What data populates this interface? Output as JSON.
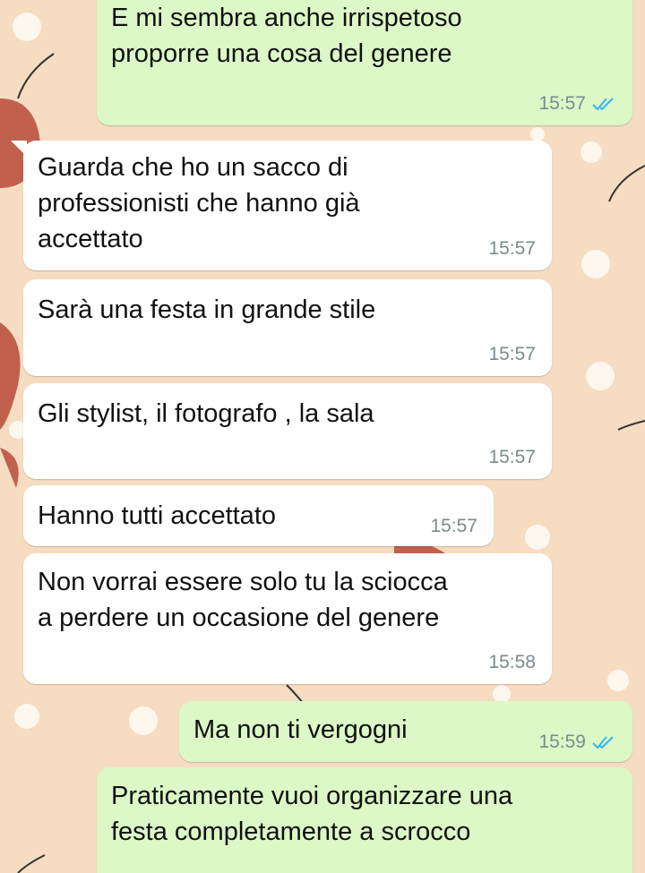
{
  "colors": {
    "wallpaper": "#f6dcc0",
    "incoming_bubble": "#ffffff",
    "outgoing_bubble": "#dcf8c6",
    "timestamp": "#7d8a8f",
    "read_ticks": "#34b7f1"
  },
  "messages": [
    {
      "direction": "outgoing",
      "text": "E mi sembra anche irrispetoso\nproporre una cosa del genere",
      "time": "15:57",
      "status_icon": "double-check-read-icon"
    },
    {
      "direction": "incoming",
      "text": "Guarda che ho un sacco di\nprofessionisti che hanno già\naccettato",
      "time": "15:57"
    },
    {
      "direction": "incoming",
      "text": "Sarà una festa in grande stile",
      "time": "15:57"
    },
    {
      "direction": "incoming",
      "text": "Gli stylist, il fotografo , la sala",
      "time": "15:57"
    },
    {
      "direction": "incoming",
      "text": "Hanno tutti accettato",
      "time": "15:57"
    },
    {
      "direction": "incoming",
      "text": "Non vorrai essere solo tu la sciocca\na perdere un occasione del genere",
      "time": "15:58"
    },
    {
      "direction": "outgoing",
      "text": "Ma non ti vergogni",
      "time": "15:59",
      "status_icon": "double-check-read-icon"
    },
    {
      "direction": "outgoing",
      "text": "Praticamente vuoi organizzare una\nfesta completamente a scrocco",
      "time": "",
      "status_icon": "double-check-read-icon"
    }
  ]
}
